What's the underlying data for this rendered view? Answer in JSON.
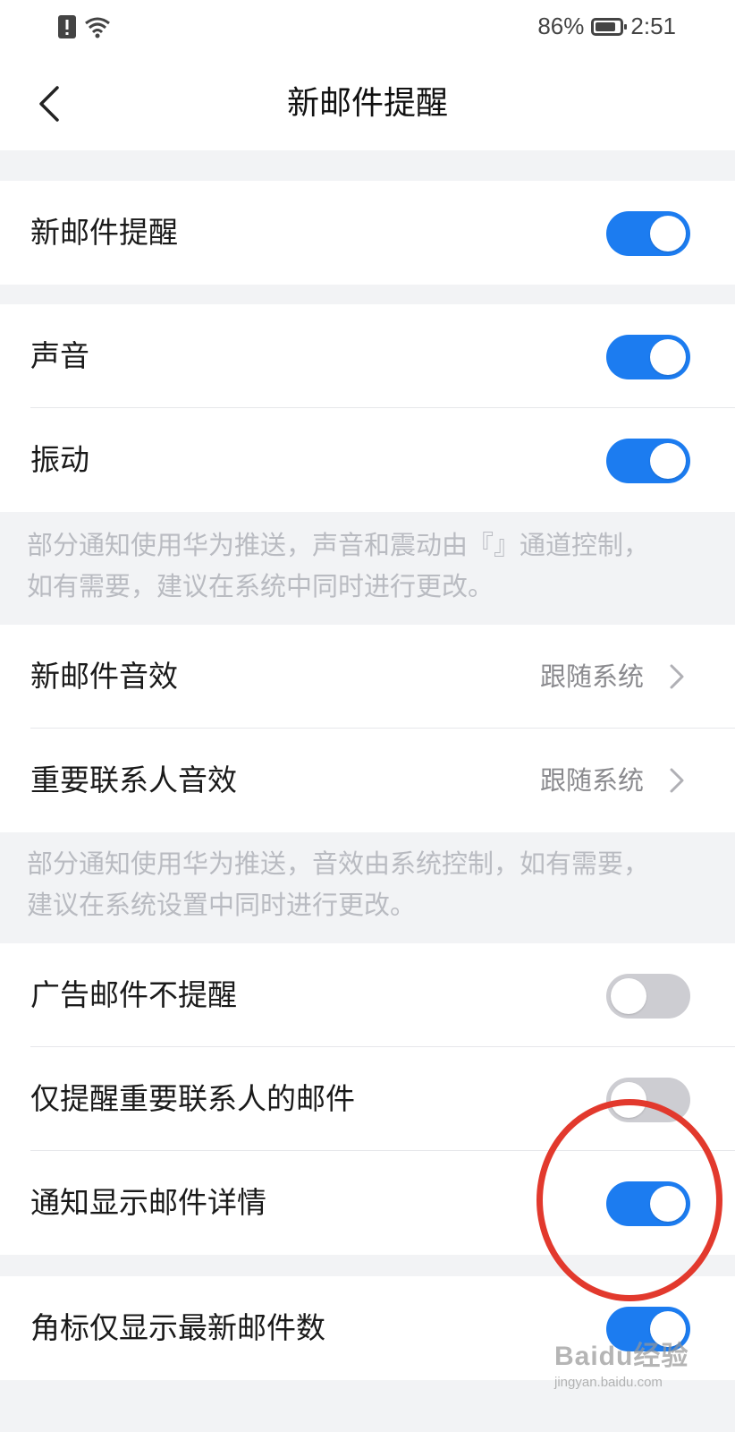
{
  "status_bar": {
    "battery": "86%",
    "time": "2:51",
    "battery_level": 0.86,
    "icons": [
      "alert-icon",
      "wifi-icon"
    ]
  },
  "header": {
    "title": "新邮件提醒",
    "back_icon": "chevron-left-icon"
  },
  "colors": {
    "accent": "#1c7cf0",
    "toggle_off": "#cdcdd2",
    "background": "#f2f3f5",
    "annotation": "#e2392d"
  },
  "sections": {
    "main": {
      "new_mail_alert": {
        "label": "新邮件提醒",
        "on": true
      }
    },
    "sound_vibration": {
      "sound": {
        "label": "声音",
        "on": true
      },
      "vibration": {
        "label": "振动",
        "on": true
      },
      "note": "部分通知使用华为推送，声音和震动由『』通道控制，如有需要，建议在系统中同时进行更改。"
    },
    "sound_effects": {
      "new_mail_sound": {
        "label": "新邮件音效",
        "value": "跟随系统"
      },
      "vip_sound": {
        "label": "重要联系人音效",
        "value": "跟随系统"
      },
      "note": "部分通知使用华为推送，音效由系统控制，如有需要，建议在系统设置中同时进行更改。"
    },
    "filters": {
      "ad_mail_no_alert": {
        "label": "广告邮件不提醒",
        "on": false
      },
      "vip_only": {
        "label": "仅提醒重要联系人的邮件",
        "on": false
      },
      "show_details": {
        "label": "通知显示邮件详情",
        "on": true
      }
    },
    "badge": {
      "badge_latest_only": {
        "label": "角标仅显示最新邮件数",
        "on": true
      }
    }
  },
  "watermark": {
    "main": "Baidu经验",
    "sub": "jingyan.baidu.com"
  }
}
